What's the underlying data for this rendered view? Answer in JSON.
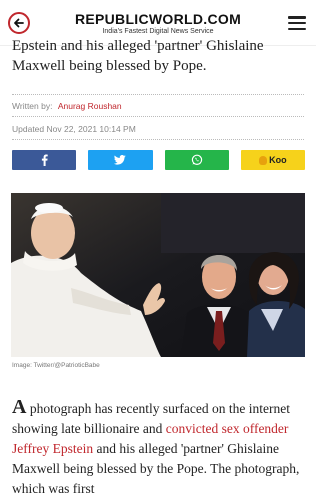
{
  "header": {
    "brand": "REPUBLICWORLD.COM",
    "tagline": "India's Fastest Digital News Service"
  },
  "article": {
    "headline_tail_line1": "Epstein and his alleged 'partner' Ghislaine",
    "headline_tail_line2": "Maxwell being blessed by Pope.",
    "written_by_label": "Written by:",
    "author": "Anurag Roushan",
    "updated": "Updated Nov 22, 2021 10:14 PM",
    "image_caption": "Image: Twitter/@PatrioticBabe",
    "body": {
      "dropcap": "A",
      "part1": " photograph has recently surfaced on the internet showing late billionaire and ",
      "link_text": "convicted sex offender Jeffrey Epstein",
      "part2": " and his alleged 'partner' Ghislaine Maxwell being blessed by the Pope. The photograph, which was first"
    }
  },
  "share": {
    "facebook_icon": "facebook-icon",
    "twitter_icon": "twitter-icon",
    "whatsapp_icon": "whatsapp-icon",
    "koo_label": "Koo"
  },
  "colors": {
    "brand_red": "#c0272d",
    "facebook": "#3b5998",
    "twitter": "#1da1f2",
    "whatsapp": "#25b54a",
    "koo": "#f6d21b"
  }
}
